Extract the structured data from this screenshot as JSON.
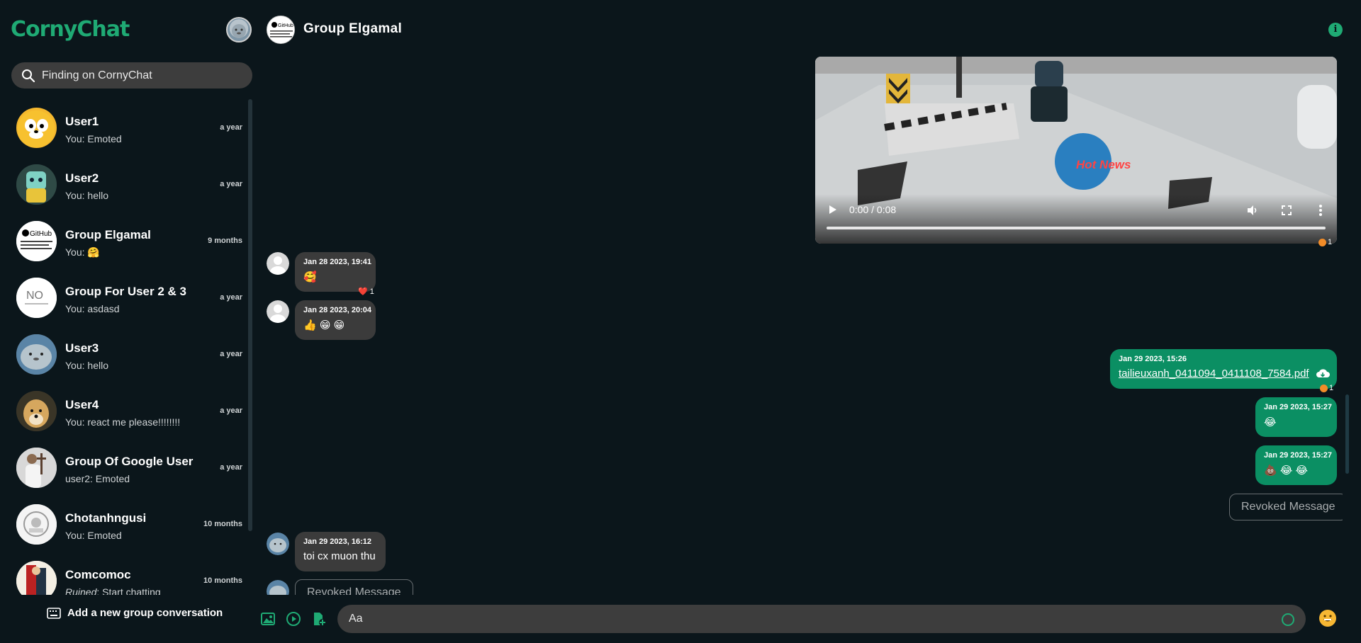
{
  "app": {
    "logo": "CornyChat",
    "accent": "#1faa74"
  },
  "search": {
    "placeholder": "Finding on CornyChat"
  },
  "conversations": [
    {
      "name": "User1",
      "last": "You: Emoted",
      "time": "a year"
    },
    {
      "name": "User2",
      "last": "You: hello",
      "time": "a year"
    },
    {
      "name": "Group Elgamal",
      "last": "You: 🤗",
      "time": "9 months"
    },
    {
      "name": "Group For User 2 & 3",
      "last": "You: asdasd",
      "time": "a year"
    },
    {
      "name": "User3",
      "last": "You: hello",
      "time": "a year"
    },
    {
      "name": "User4",
      "last": "You: react me please!!!!!!!!",
      "time": "a year"
    },
    {
      "name": "Group Of Google User",
      "last": "user2: Emoted",
      "time": "a year"
    },
    {
      "name": "Chotanhngusi",
      "last": "You: Emoted",
      "time": "10 months"
    },
    {
      "name": "Comcomoc",
      "last_prefix": "Ruined",
      "last": ": Start chatting",
      "time": "10 months"
    }
  ],
  "sidebar_footer": {
    "add_group": "Add a new group conversation"
  },
  "header": {
    "title": "Group Elgamal",
    "group_avatar_text": "GitHub",
    "group_avatar_alt": "NO"
  },
  "video": {
    "time": "0:00 / 0:08",
    "overlay_text": "Hot News",
    "reaction_count": "1"
  },
  "messages": [
    {
      "id": "m1",
      "time": "Jan 28 2023, 19:41",
      "text": "🥰",
      "reaction": "❤️ 1"
    },
    {
      "id": "m2",
      "time": "Jan 28 2023, 20:04",
      "text": "👍 😁 😁"
    },
    {
      "id": "m3",
      "time": "Jan 29 2023, 15:26",
      "file": "tailieuxanh_0411094_0411108_7584.pdf",
      "reaction": "1"
    },
    {
      "id": "m4",
      "time": "Jan 29 2023, 15:27",
      "text": "😂"
    },
    {
      "id": "m5",
      "time": "Jan 29 2023, 15:27",
      "text": "💩 😂 😂"
    },
    {
      "id": "m6",
      "revoked": "Revoked Message"
    },
    {
      "id": "m7",
      "time": "Jan 29 2023, 16:12",
      "text": "toi cx muon thu"
    },
    {
      "id": "m8",
      "revoked": "Revoked Message"
    }
  ],
  "composer": {
    "placeholder": "Aa"
  }
}
